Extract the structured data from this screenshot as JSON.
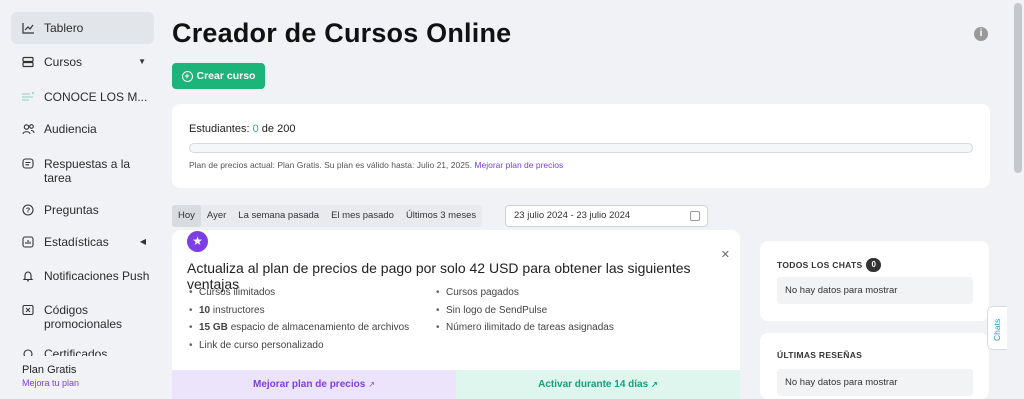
{
  "sidebar": {
    "items": [
      {
        "label": "Tablero",
        "icon": "chart-line-icon"
      },
      {
        "label": "Cursos",
        "icon": "layers-icon"
      },
      {
        "label": "CONOCE LOS M...",
        "icon": "course-thumb-icon"
      },
      {
        "label": "Audiencia",
        "icon": "users-icon"
      },
      {
        "label": "Respuestas a la tarea",
        "icon": "message-icon"
      },
      {
        "label": "Preguntas",
        "icon": "question-icon"
      },
      {
        "label": "Estadísticas",
        "icon": "stats-icon"
      },
      {
        "label": "Notificaciones Push",
        "icon": "bell-icon"
      },
      {
        "label": "Códigos promocionales",
        "icon": "coupon-icon"
      },
      {
        "label": "Certificados",
        "icon": "certificate-icon"
      }
    ],
    "plan": {
      "title": "Plan Gratis",
      "link": "Mejora tu plan"
    }
  },
  "main": {
    "title": "Creador de Cursos Online",
    "create_button": "Crear curso",
    "students": {
      "label": "Estudiantes:",
      "count": "0",
      "of": "de 200",
      "progress": 0,
      "plan_note": "Plan de precios actual: Plan Gratis. Su plan es válido hasta: Julio 21, 2025.",
      "plan_link": "Mejorar plan de precios"
    },
    "ranges": [
      "Hoy",
      "Ayer",
      "La semana pasada",
      "El mes pasado",
      "Últimos 3 meses"
    ],
    "date_range": "23 julio 2024 - 23 julio 2024",
    "promo": {
      "title": "Actualiza al plan de precios de pago por solo 42 USD para obtener las siguientes ventajas",
      "col1": [
        {
          "strong": "",
          "text": "Cursos ilimitados"
        },
        {
          "strong": "10",
          "text": "instructores"
        },
        {
          "strong": "15 GB",
          "text": "espacio de almacenamiento de archivos"
        },
        {
          "strong": "",
          "text": "Link de curso personalizado"
        }
      ],
      "col2": [
        "Cursos pagados",
        "Sin logo de SendPulse",
        "Número ilimitado de tareas asignadas"
      ],
      "upgrade": "Mejorar plan de precios",
      "trial": "Activar durante 14 días"
    },
    "chats": {
      "title": "TODOS LOS CHATS",
      "count": "0",
      "empty": "No hay datos para mostrar"
    },
    "reviews": {
      "title": "ÚLTIMAS RESEÑAS",
      "empty": "No hay datos para mostrar"
    },
    "chats_tab": "Chats"
  },
  "colors": {
    "accent": "#1db47a",
    "purple": "#7b3fe4",
    "teal": "#1db4a0"
  }
}
